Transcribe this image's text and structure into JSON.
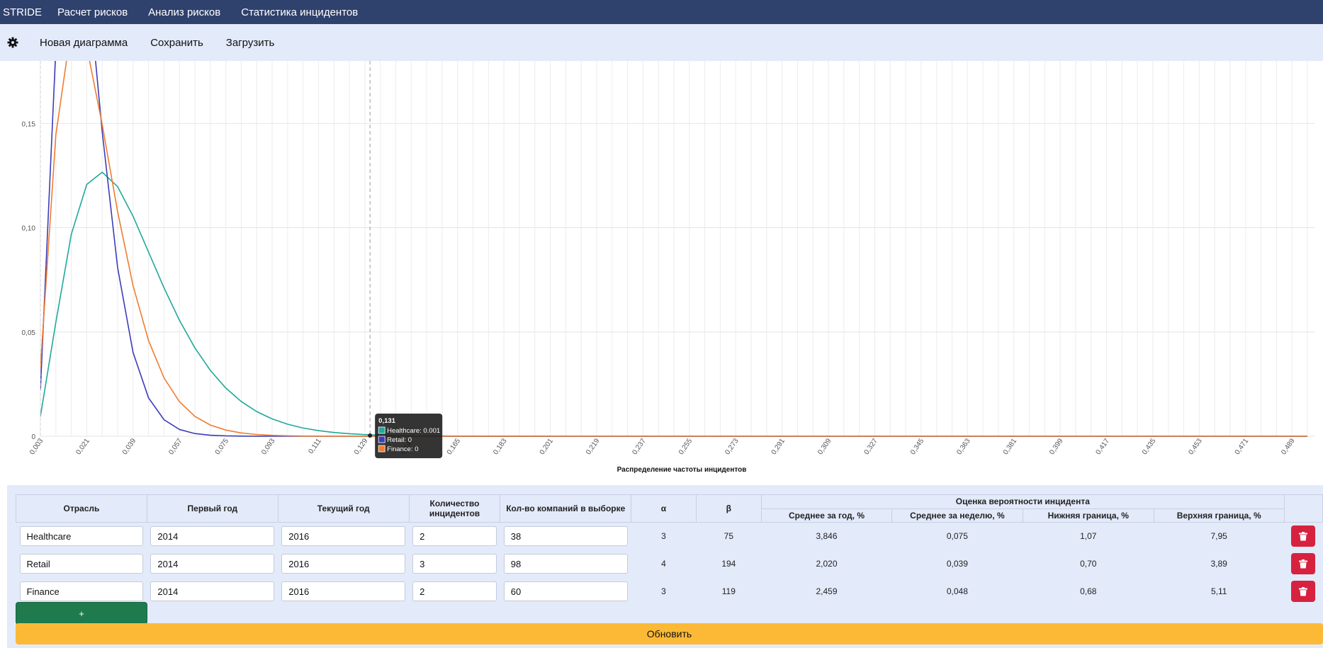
{
  "nav": {
    "brand": "STRIDE",
    "links": [
      "Расчет рисков",
      "Анализ рисков",
      "Статистика инцидентов"
    ]
  },
  "toolbar": {
    "settings_icon": "gear-icon",
    "new_label": "Новая диаграмма",
    "save_label": "Сохранить",
    "load_label": "Загрузить"
  },
  "chart_data": {
    "type": "line",
    "xlabel": "Распределение частоты инцидентов",
    "ylabel": "",
    "ylim": [
      0,
      0.18
    ],
    "yticks": [
      "0",
      "0.05",
      "0.10",
      "0.15"
    ],
    "x_start": 0.003,
    "x_step": 0.006,
    "x_end": 0.495,
    "hover": {
      "x": "0,131",
      "items": [
        {
          "name": "Healthcare",
          "value": "0.001"
        },
        {
          "name": "Retail",
          "value": "0"
        },
        {
          "name": "Finance",
          "value": "0"
        }
      ]
    },
    "series": [
      {
        "name": "Healthcare",
        "color": "#20a89a",
        "alpha": 3,
        "beta": 75
      },
      {
        "name": "Retail",
        "color": "#3b3db8",
        "alpha": 4,
        "beta": 194
      },
      {
        "name": "Finance",
        "color": "#ef7c32",
        "alpha": 3,
        "beta": 119
      }
    ],
    "grid": true
  },
  "table": {
    "headers": {
      "industry": "Отрасль",
      "first_year": "Первый год",
      "current_year": "Текущий год",
      "incidents": "Количество инцидентов",
      "companies": "Кол-во компаний в выборке",
      "alpha": "α",
      "beta": "β",
      "estimate_group": "Оценка вероятности инцидента",
      "mean_year": "Среднее за год, %",
      "mean_week": "Среднее за неделю, %",
      "lower": "Нижняя граница, %",
      "upper": "Верхняя граница, %"
    },
    "rows": [
      {
        "industry": "Healthcare",
        "first_year": "2014",
        "current_year": "2016",
        "incidents": "2",
        "companies": "38",
        "alpha": "3",
        "beta": "75",
        "mean_year": "3,846",
        "mean_week": "0,075",
        "lower": "1,07",
        "upper": "7,95"
      },
      {
        "industry": "Retail",
        "first_year": "2014",
        "current_year": "2016",
        "incidents": "3",
        "companies": "98",
        "alpha": "4",
        "beta": "194",
        "mean_year": "2,020",
        "mean_week": "0,039",
        "lower": "0,70",
        "upper": "3,89"
      },
      {
        "industry": "Finance",
        "first_year": "2014",
        "current_year": "2016",
        "incidents": "2",
        "companies": "60",
        "alpha": "3",
        "beta": "119",
        "mean_year": "2,459",
        "mean_week": "0,048",
        "lower": "0,68",
        "upper": "5,11"
      }
    ],
    "add_label": "+",
    "update_label": "Обновить",
    "delete_icon": "trash-icon"
  }
}
